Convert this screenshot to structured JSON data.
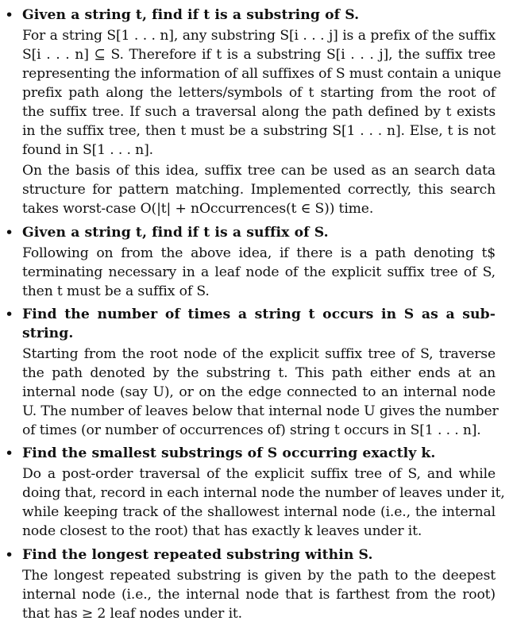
{
  "items": [
    {
      "heading": [
        "Given a string t, find if t is a substring of S."
      ],
      "body": [
        "For a string S[1 . . . n], any substring S[i . . . j] is a prefix of the suffix",
        "S[i . . . n] ⊆ S.  Therefore if t is a substring S[i . . . j], the suffix tree",
        "representing the information of all suffixes of S must contain a unique",
        "prefix path along the letters/symbols of t starting from the root of",
        "the suffix tree. If such a traversal along the path defined by t exists",
        "in the suffix tree, then t must be a substring S[1 . . . n]. Else, t is not",
        "found in S[1 . . . n].",
        "On the basis of this idea, suffix tree can be used as an search data",
        "structure for pattern matching.  Implemented correctly, this search",
        "takes worst-case O(|t| + nOccurrences(t ∈ S)) time."
      ]
    },
    {
      "heading": [
        "Given a string t, find if t is a suffix of S."
      ],
      "body": [
        "Following on from the above idea, if there is a path denoting t$",
        "terminating necessary in a leaf node of the explicit suffix tree of S,",
        "then t must be a suffix of S."
      ]
    },
    {
      "heading": [
        "Find the number of times a string t occurs in S as a sub-",
        "string."
      ],
      "body": [
        "Starting from the root node of the explicit suffix tree of S, traverse",
        "the path denoted by the substring t.  This path either ends at an",
        "internal node (say U), or on the edge connected to an internal node",
        "U. The number of leaves below that internal node U gives the number",
        "of times (or number of occurrences of) string t occurs in S[1 . . . n]."
      ]
    },
    {
      "heading": [
        "Find the smallest substrings of S occurring exactly k."
      ],
      "body": [
        "Do a post-order traversal of the explicit suffix tree of S, and while",
        "doing that, record in each internal node the number of leaves under it,",
        "while keeping track of the shallowest internal node (i.e., the internal",
        "node closest to the root) that has exactly k leaves under it."
      ]
    },
    {
      "heading": [
        "Find the longest repeated substring within S."
      ],
      "body": [
        "The longest repeated substring is given by the path to the deepest",
        "internal node (i.e., the internal node that is farthest from the root)",
        "that has ≥ 2 leaf nodes under it."
      ]
    }
  ]
}
